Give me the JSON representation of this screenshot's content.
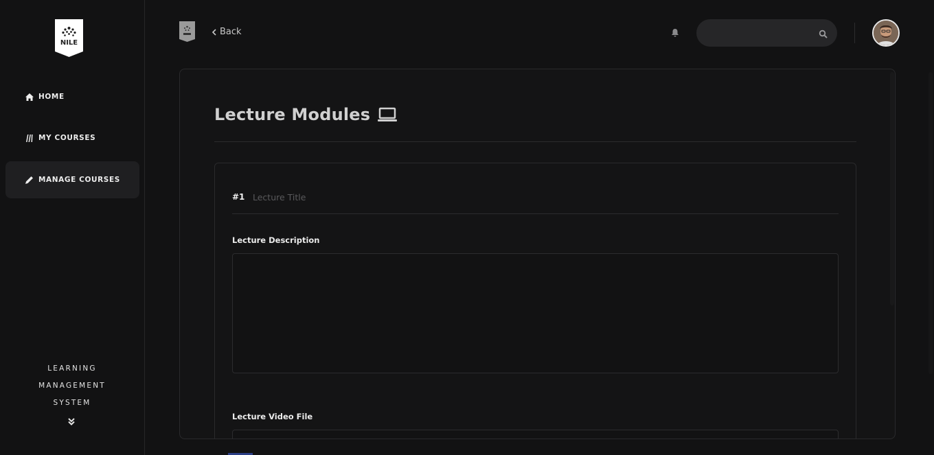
{
  "brand": {
    "logo_text": "NILE"
  },
  "sidebar": {
    "items": [
      {
        "label": "HOME",
        "icon": "home-icon",
        "active": false
      },
      {
        "label": "MY COURSES",
        "icon": "books-icon",
        "active": false
      },
      {
        "label": "MANAGE COURSES",
        "icon": "pencil-icon",
        "active": true
      }
    ],
    "footer_lines": [
      "LEARNING",
      "MANAGEMENT",
      "SYSTEM"
    ],
    "footer_icon": "double-chevron-down-icon"
  },
  "header": {
    "back_label": "Back",
    "search": {
      "placeholder": "",
      "value": ""
    },
    "icons": {
      "bell": "bell-icon",
      "search": "search-icon",
      "avatar": "user-avatar"
    }
  },
  "main": {
    "title": "Lecture Modules",
    "title_icon": "laptop-icon",
    "module": {
      "number": "#1",
      "title_placeholder": "Lecture Title",
      "description_label": "Lecture Description",
      "description_value": "",
      "video_label": "Lecture Video File"
    }
  },
  "colors": {
    "background": "#121213",
    "panel": "#141415",
    "active_nav": "#1f1f21",
    "search_bg": "#262628",
    "accent_bottom": "#2c3f86"
  }
}
